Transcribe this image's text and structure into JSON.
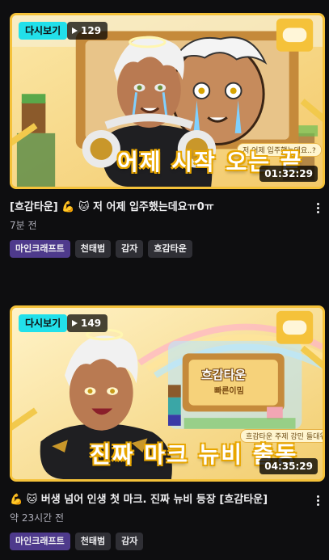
{
  "colors": {
    "accent_cyan": "#22e0ea",
    "thumb_border": "#f5c23a",
    "category_tag": "#4e3a8c",
    "tag": "#2f2f35"
  },
  "videos": [
    {
      "rerun_label": "다시보기",
      "views": "129",
      "duration": "01:32:29",
      "overlay_caption": "어제 시작 오는 끝",
      "overlay_sub": "저 어제 입주했는데요..?",
      "title": "[흐감타운] 💪 🐱 저 어제 입주했는데요ㅠ0ㅠ",
      "time_ago": "7분 전",
      "tags": [
        "마인크래프트",
        "천태범",
        "감자",
        "흐감타운"
      ],
      "icons": [
        "play-icon",
        "gamepad-icon",
        "more-vertical-icon"
      ]
    },
    {
      "rerun_label": "다시보기",
      "views": "149",
      "duration": "04:35:29",
      "overlay_caption": "진짜 마크 뉴비 출동",
      "overlay_sub": "흐감타운 주제 강민 들대위",
      "sign_title": "흐감타운",
      "sign_sub": "빠른이밈",
      "title": "💪 🐱 버생 넘어 인생 첫 마크. 진짜 뉴비 등장 [흐감타운]",
      "time_ago": "약 23시간 전",
      "tags": [
        "마인크래프트",
        "천태범",
        "감자"
      ],
      "icons": [
        "play-icon",
        "gamepad-icon",
        "more-vertical-icon"
      ]
    }
  ]
}
